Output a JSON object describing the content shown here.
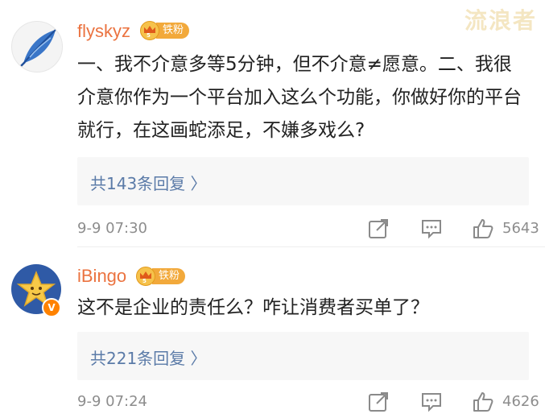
{
  "watermark": "流浪者",
  "comments": [
    {
      "username": "flyskyz",
      "badge": "铁粉",
      "content": "一、我不介意多等5分钟，但不介意≠愿意。二、我很介意你作为一个平台加入这么个功能，你做好你的平台就行，在这画蛇添足，不嫌多戏么?",
      "replies": "共143条回复 〉",
      "time": "9-9 07:30",
      "likes": "5643",
      "avatar_icon": "feather-icon"
    },
    {
      "username": "iBingo",
      "badge": "铁粉",
      "content": "这不是企业的责任么？咋让消费者买单了？",
      "replies": "共221条回复 〉",
      "time": "9-9 07:24",
      "likes": "4626",
      "avatar_icon": "star-icon",
      "verified": "V"
    }
  ],
  "colors": {
    "username": "#eb7340",
    "replies": "#5b7ba8",
    "badge": "#f2a93b"
  }
}
